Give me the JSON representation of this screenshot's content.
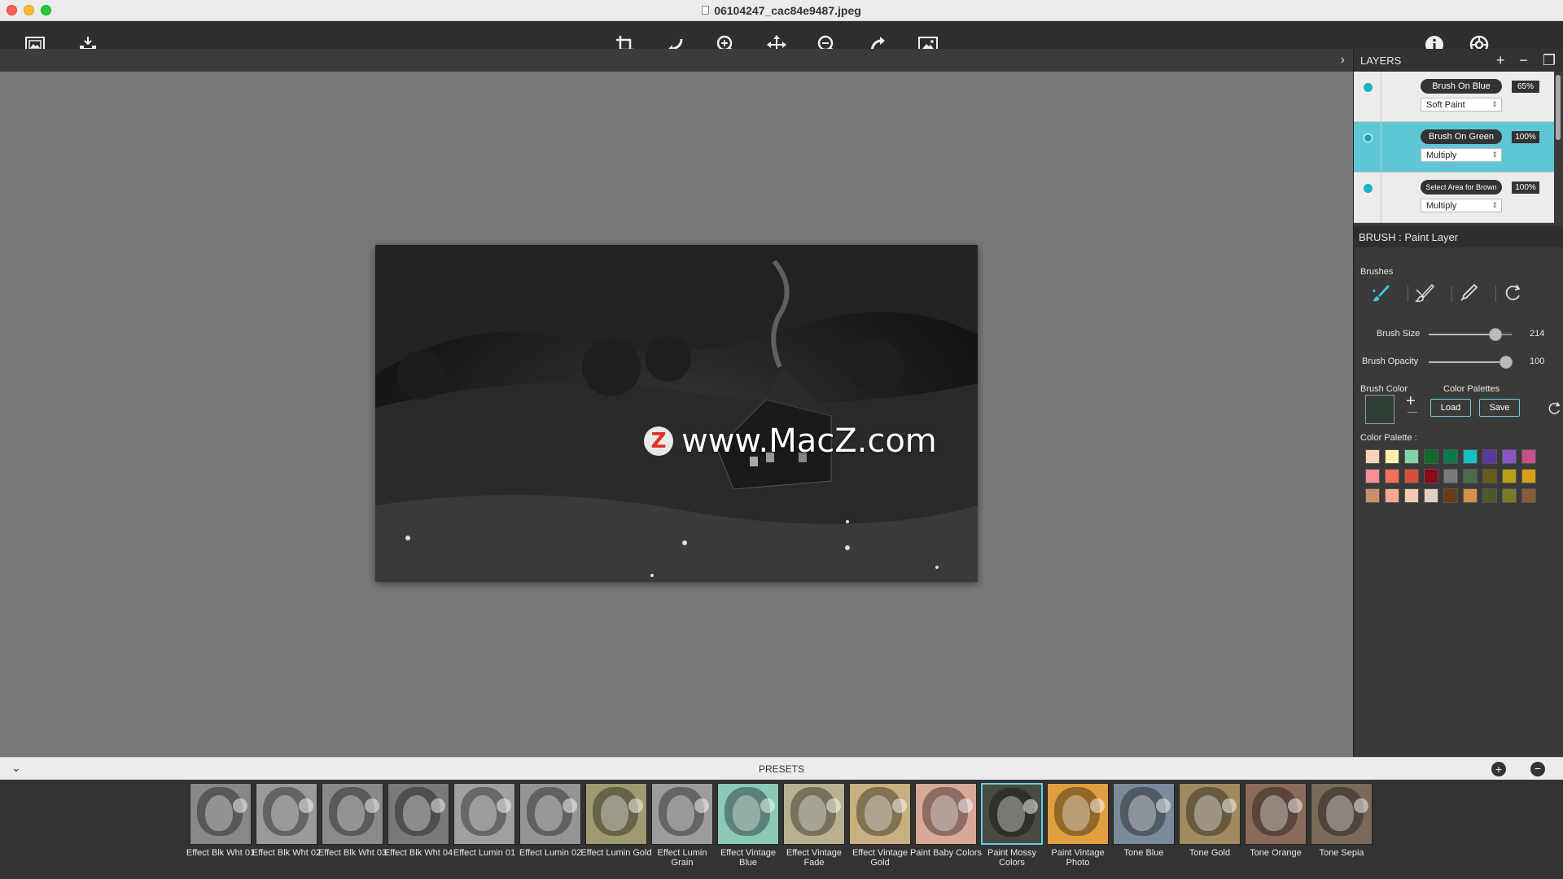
{
  "window": {
    "title": "06104247_cac84e9487.jpeg"
  },
  "toolbar": {
    "left": [
      {
        "name": "open-image"
      },
      {
        "name": "save-export"
      }
    ],
    "center": [
      {
        "name": "crop"
      },
      {
        "name": "rotate-left"
      },
      {
        "name": "zoom-in"
      },
      {
        "name": "pan"
      },
      {
        "name": "zoom-out"
      },
      {
        "name": "rotate-right"
      },
      {
        "name": "fit-image"
      }
    ],
    "right": [
      {
        "name": "info"
      },
      {
        "name": "settings"
      }
    ]
  },
  "canvas": {
    "watermark_text": "www.MacZ.com",
    "watermark_logo": "Z"
  },
  "layers": {
    "title": "LAYERS",
    "items": [
      {
        "name": "Brush On Blue",
        "opacity": "65%",
        "mode": "Soft Paint",
        "active": false
      },
      {
        "name": "Brush On Green",
        "opacity": "100%",
        "mode": "Multiply",
        "active": true
      },
      {
        "name": "Select Area for Brown",
        "opacity": "100%",
        "mode": "Multiply",
        "active": false
      }
    ]
  },
  "brush": {
    "header": "BRUSH : Paint Layer",
    "brushes_label": "Brushes",
    "brush_size_label": "Brush Size",
    "brush_size_value": "214",
    "brush_size_fraction": 0.8,
    "brush_opacity_label": "Brush Opacity",
    "brush_opacity_value": "100",
    "brush_opacity_fraction": 0.93,
    "brush_color_label": "Brush Color",
    "color_palettes_label": "Color Palettes",
    "load_label": "Load",
    "save_label": "Save",
    "color_palette_label": "Color Palette :",
    "current_color": "#2f3d34",
    "palette": [
      "#fbd3b8",
      "#fdf0a8",
      "#7fd3a8",
      "#0f6a2a",
      "#0b7a4a",
      "#12c2c2",
      "#5a3aa0",
      "#8a55c8",
      "#c8508a",
      "#f48f98",
      "#f07058",
      "#d8503a",
      "#8a0a1a",
      "#7a7a7a",
      "#4a6a4a",
      "#6a5a1a",
      "#b8a018",
      "#d8a010",
      "#c8906a",
      "#f8a890",
      "#f2c8b0",
      "#e0d0c0",
      "#6a3a1a",
      "#d8904a",
      "#4a5a2a",
      "#7a7a2a",
      "#8a5a3a"
    ]
  },
  "presets": {
    "title": "PRESETS",
    "items": [
      {
        "label": "Effect Blk Wht 01",
        "tint": "#888888"
      },
      {
        "label": "Effect Blk Wht 02",
        "tint": "#9a9a9a"
      },
      {
        "label": "Effect Blk Wht 03",
        "tint": "#8a8a8a"
      },
      {
        "label": "Effect Blk Wht 04",
        "tint": "#7a7a7a"
      },
      {
        "label": "Effect Lumin 01",
        "tint": "#a0a0a0"
      },
      {
        "label": "Effect Lumin 02",
        "tint": "#959595"
      },
      {
        "label": "Effect Lumin Gold",
        "tint": "#a09a70"
      },
      {
        "label": "Effect Lumin Grain",
        "tint": "#9c9c9c"
      },
      {
        "label": "Effect Vintage Blue",
        "tint": "#8ac8b8"
      },
      {
        "label": "Effect Vintage Fade",
        "tint": "#b8b090"
      },
      {
        "label": "Effect Vintage Gold",
        "tint": "#c8b080"
      },
      {
        "label": "Paint Baby Colors",
        "tint": "#d8a898"
      },
      {
        "label": "Paint Mossy Colors",
        "tint": "#4a4a42",
        "selected": true
      },
      {
        "label": "Paint Vintage Photo",
        "tint": "#e0a040"
      },
      {
        "label": "Tone Blue",
        "tint": "#7a8a9a"
      },
      {
        "label": "Tone Gold",
        "tint": "#a08a60"
      },
      {
        "label": "Tone Orange",
        "tint": "#8a6a5a"
      },
      {
        "label": "Tone Sepia",
        "tint": "#7a6a5a"
      }
    ]
  }
}
